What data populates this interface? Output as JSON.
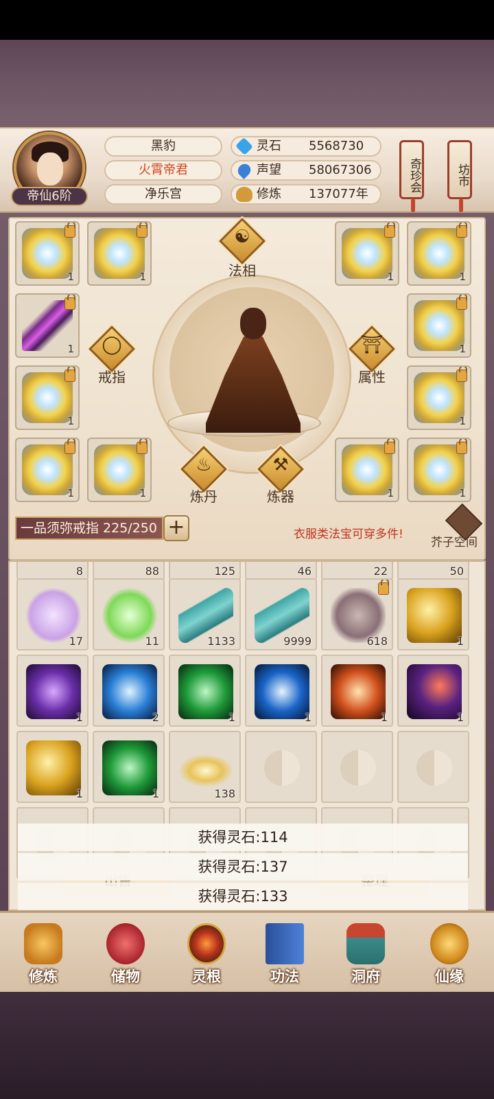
{
  "player": {
    "rank": "帝仙6阶",
    "name": "黑豹",
    "title": "火霄帝君",
    "sect": "净乐宫"
  },
  "resources": [
    {
      "label": "灵石",
      "value": "5568730",
      "icon": "spirit-stone-icon",
      "color": "#3aa3e8"
    },
    {
      "label": "声望",
      "value": "58067306",
      "icon": "prestige-crystal-icon",
      "color": "#3b7fd6"
    },
    {
      "label": "修炼",
      "value": "137077年",
      "icon": "meditation-icon",
      "color": "#d29a3a"
    }
  ],
  "header_buttons": {
    "treasure": "奇珍会",
    "market": "坊市"
  },
  "equip": {
    "center_label": "法相",
    "ring_label": "戒指",
    "attr_label": "属性",
    "alchemy_label": "炼丹",
    "forge_label": "炼器",
    "slot_counts": [
      "1",
      "1",
      "1",
      "1",
      "1",
      "1",
      "1",
      "1",
      "1",
      "1",
      "1",
      "1",
      "1",
      "1"
    ]
  },
  "ring_bar": {
    "name": "一品须弥戒指 225/250",
    "plus": "+"
  },
  "notice": "衣服类法宝可穿多件!",
  "mustard_space": "芥子空间",
  "inventory": {
    "partial_row": [
      "8",
      "88",
      "125",
      "46",
      "22",
      "50"
    ],
    "row1": [
      {
        "name": "lotus",
        "count": "17",
        "color": "#c9a2e6"
      },
      {
        "name": "spirit-herb",
        "count": "11",
        "color": "#7ed957"
      },
      {
        "name": "scroll",
        "count": "1133",
        "color": "#3fa6a6"
      },
      {
        "name": "scroll",
        "count": "9999",
        "color": "#3fa6a6"
      },
      {
        "name": "beast-relic",
        "count": "618",
        "color": "#8a6f78"
      },
      {
        "name": "golden-dragon",
        "count": "1",
        "color": "#d9a21e"
      }
    ],
    "row2": [
      {
        "name": "purple-flame",
        "count": "1",
        "color": "#6a2fa8"
      },
      {
        "name": "blue-skull",
        "count": "2",
        "color": "#2a7fd6"
      },
      {
        "name": "green-dragon",
        "count": "1",
        "color": "#1f9b3a"
      },
      {
        "name": "blue-orb",
        "count": "1",
        "color": "#1a64c8"
      },
      {
        "name": "phoenix",
        "count": "1",
        "color": "#d2521e"
      },
      {
        "name": "purple-claw",
        "count": "1",
        "color": "#5a2280"
      }
    ],
    "row3": [
      {
        "name": "golden-dragon",
        "count": "1",
        "color": "#d9a21e"
      },
      {
        "name": "green-dragon",
        "count": "1",
        "color": "#1f9b3a"
      },
      {
        "name": "feather-crystal",
        "count": "138",
        "color": "#e8c35a"
      }
    ]
  },
  "toasts": [
    "获得灵石:114",
    "获得灵石:137",
    "获得灵石:133"
  ],
  "bottom_buttons": {
    "sell": "出售",
    "sort": "整理"
  },
  "nav": [
    "修炼",
    "储物",
    "灵根",
    "功法",
    "洞府",
    "仙缘"
  ]
}
